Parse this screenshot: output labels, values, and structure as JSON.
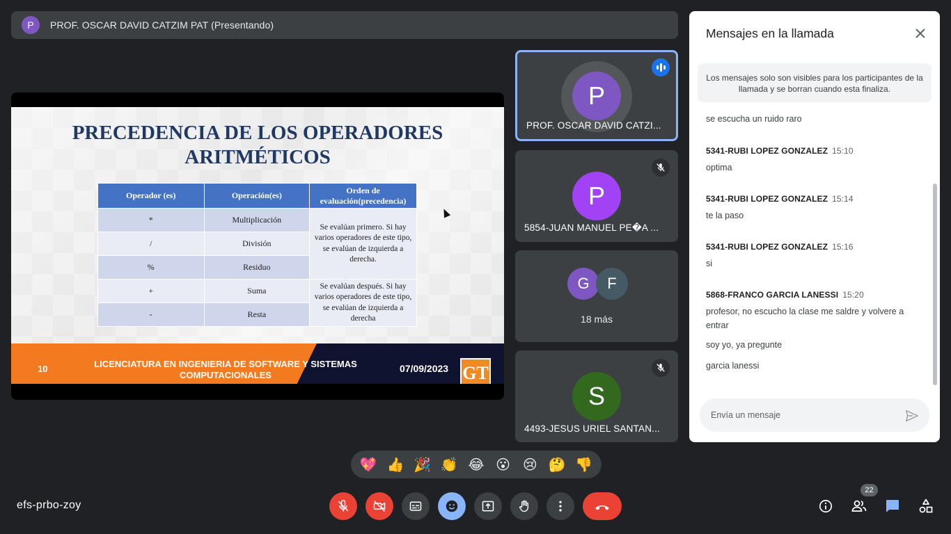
{
  "presenter_bar": {
    "avatar_letter": "P",
    "text": "PROF. OSCAR DAVID CATZIM PAT (Presentando)"
  },
  "slide": {
    "title_line1": "PRECEDENCIA DE LOS OPERADORES",
    "title_line2": "ARITMÉTICOS",
    "table": {
      "headers": [
        "Operador (es)",
        "Operación(es)",
        "Orden de evaluación(precedencia)"
      ],
      "rows": [
        {
          "op": "*",
          "name": "Multiplicación"
        },
        {
          "op": "/",
          "name": "División"
        },
        {
          "op": "%",
          "name": "Residuo"
        },
        {
          "op": "+",
          "name": "Suma"
        },
        {
          "op": "-",
          "name": "Resta"
        }
      ],
      "order_first": "Se evalúan primero. Si hay varios operadores de este tipo, se evalúan de izquierda a derecha.",
      "order_after": "Se evalúan después. Si hay varios operadores de este tipo, se evalúan de izquierda a derecha"
    },
    "page_number": "10",
    "program": "LICENCIATURA EN INGENIERIA DE SOFTWARE Y SISTEMAS COMPUTACIONALES",
    "date": "07/09/2023",
    "logo_text": "GT"
  },
  "tiles": [
    {
      "letter": "P",
      "name": "PROF. OSCAR DAVID CATZI...",
      "color": "#7e57c2",
      "state": "speaking"
    },
    {
      "letter": "P",
      "name": "5854-JUAN MANUEL PE�A ...",
      "color": "#a142f4",
      "state": "muted"
    },
    {
      "group_letters": [
        "G",
        "F"
      ],
      "group_colors": [
        "#7e57c2",
        "#455a64"
      ],
      "more": "18 más"
    },
    {
      "letter": "S",
      "name": "4493-JESUS URIEL SANTAN...",
      "color": "#33691e",
      "state": "muted"
    }
  ],
  "chat": {
    "title": "Mensajes en la llamada",
    "notice": "Los mensajes solo son visibles para los participantes de la llamada y se borran cuando esta finaliza.",
    "messages": [
      {
        "sender": "",
        "time": "",
        "texts": [
          "se escucha un ruido raro"
        ]
      },
      {
        "sender": "5341-RUBI LOPEZ GONZALEZ",
        "time": "15:10",
        "texts": [
          "optima"
        ]
      },
      {
        "sender": "5341-RUBI LOPEZ GONZALEZ",
        "time": "15:14",
        "texts": [
          "te la paso"
        ]
      },
      {
        "sender": "5341-RUBI LOPEZ GONZALEZ",
        "time": "15:16",
        "texts": [
          "si"
        ]
      },
      {
        "sender": "5868-FRANCO GARCIA LANESSI",
        "time": "15:20",
        "texts": [
          "profesor, no escucho la clase me saldre y volvere a entrar",
          "soy yo, ya pregunte",
          "garcia lanessi"
        ]
      }
    ],
    "input_placeholder": "Envía un mensaje"
  },
  "reactions": [
    "💖",
    "👍",
    "🎉",
    "👏",
    "😂",
    "😮",
    "😢",
    "🤔",
    "👎"
  ],
  "bottom": {
    "meeting_code": "efs-prbo-zoy",
    "participant_count": "22"
  },
  "colors": {
    "background": "#202124",
    "surface": "#3c4043",
    "accent": "#8ab4f8",
    "danger": "#ea4335"
  }
}
